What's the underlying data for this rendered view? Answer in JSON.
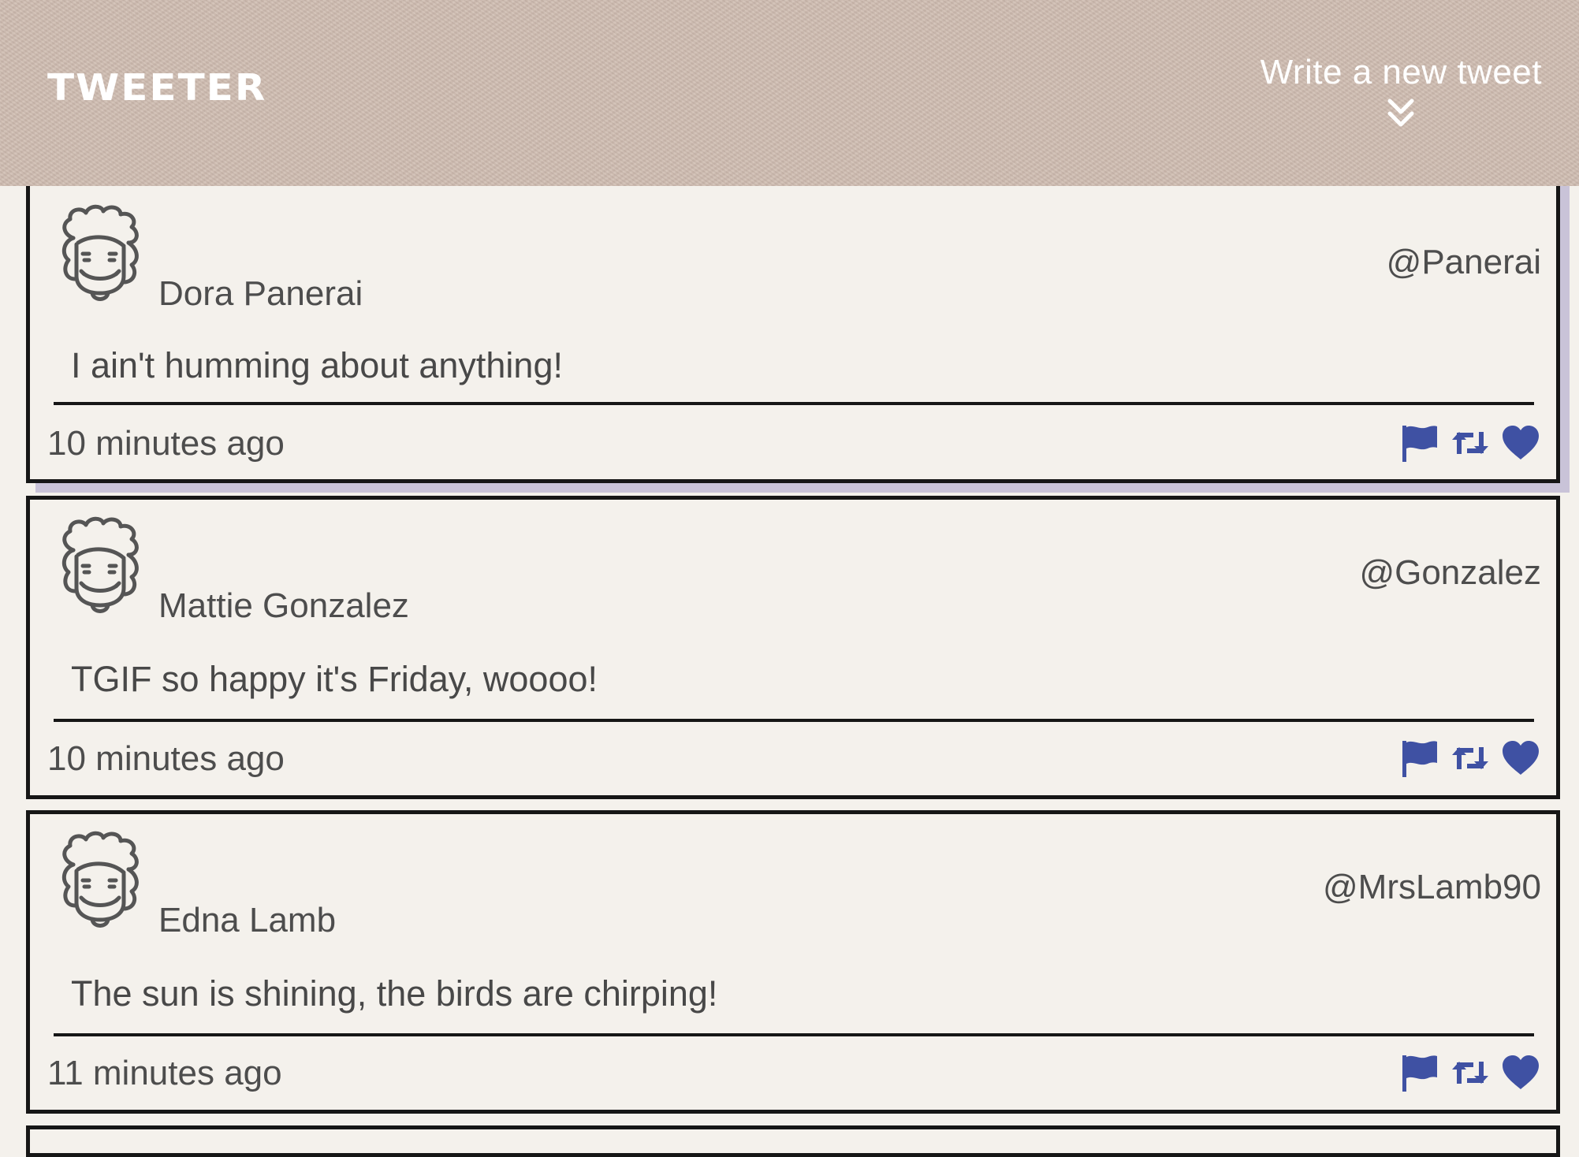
{
  "header": {
    "brand": "TWEETER",
    "compose_label": "Write a new tweet",
    "compose_icon": "chevron-double-down-icon"
  },
  "colors": {
    "header_bg": "#cfbcb0",
    "page_bg": "#f4f1ec",
    "action_icon": "#3f51a3",
    "border": "#161616",
    "hover_shadow": "#c9c3d8"
  },
  "tweets": [
    {
      "name": "Dora Panerai",
      "handle": "@Panerai",
      "text": "I ain't humming about anything!",
      "time": "10 minutes ago"
    },
    {
      "name": "Mattie Gonzalez",
      "handle": "@Gonzalez",
      "text": "TGIF so happy it's Friday, woooo!",
      "time": "10 minutes ago"
    },
    {
      "name": "Edna Lamb",
      "handle": "@MrsLamb90",
      "text": "The sun is shining, the birds are chirping!",
      "time": "11 minutes ago"
    }
  ],
  "icons": {
    "avatar": "avatar-face-icon",
    "flag": "flag-icon",
    "retweet": "retweet-icon",
    "like": "heart-icon"
  }
}
